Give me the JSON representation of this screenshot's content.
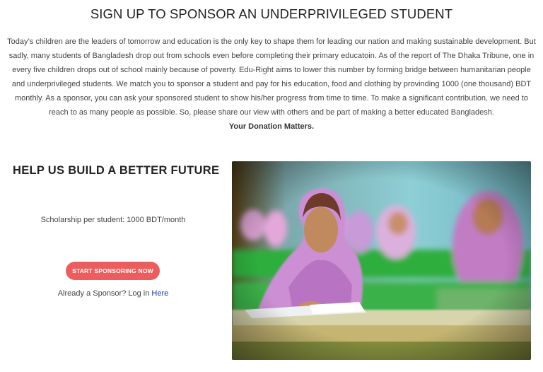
{
  "header": {
    "title": "SIGN UP TO SPONSOR AN UNDERPRIVILEGED STUDENT"
  },
  "intro": {
    "paragraph": "Today’s children are the leaders of tomorrow and education is the only key to shape them for leading our nation and making sustainable development. But sadly, many students of Bangladesh drop out from schools even before completing their primary educatoin. As of the report of The Dhaka Tribune, one in every five children drops out of school mainly because of poverty. Edu-Right aims to lower this number by forming bridge between humanitarian people and underprivileged students. We match you to sponsor a student and pay for his education, food and clothing by provinding 1000 (one thousand) BDT monthly. As a sponsor, you can ask your sponsored student to show his/her progress from time to time. To make a significant contribution, we need to reach to as many people as possible. So, please share our view with others and be part of making a better educated Bangladesh.",
    "emphasis": "Your Donation Matters."
  },
  "sponsor": {
    "heading": "HELP US BUILD A BETTER FUTURE",
    "scholarship": "Scholarship per student: 1000 BDT/month",
    "cta_label": "START SPONSORING NOW",
    "login_prefix": "Already a Sponsor? Log in ",
    "login_link": "Here"
  },
  "colors": {
    "cta": "#ee5d5d",
    "link": "#1a35b8"
  }
}
